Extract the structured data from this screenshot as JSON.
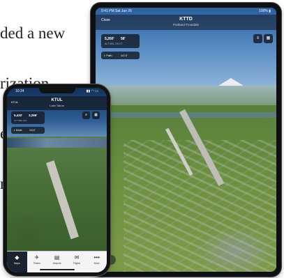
{
  "article": {
    "lines": [
      "ded a new",
      "rization",
      "egrated",
      "rt"
    ]
  },
  "tablet": {
    "status": {
      "time": "9:41 PM  Sat Jun 26",
      "right": "100% ▮"
    },
    "header": {
      "close_label": "Close",
      "title": "KTTD",
      "subtitle": "Portland-Troutdale"
    },
    "info": {
      "value_a": "5,260'",
      "value_b": "58'",
      "sub": "ALT MSL   GS KT"
    },
    "chips": {
      "a": "L Path",
      "b": "1/1.0'"
    },
    "controls": {
      "c1": "≡",
      "c2": "▦"
    }
  },
  "phone": {
    "status": {
      "time": "10:24",
      "right": "▮▮ ◠ ▭"
    },
    "header": {
      "back_label": "KTUL",
      "title": "KTUL",
      "subtitle": "Lake Tahoe"
    },
    "info": {
      "value_a": "5,432'",
      "value_b": "3,266'",
      "sub": "ALT MSL   AGL"
    },
    "chips": {
      "a": "L Mode",
      "b": "1/4,0'"
    },
    "controls": {
      "c1": "≡",
      "c2": "▦"
    },
    "tabs": [
      {
        "icon": "◆",
        "label": "Maps"
      },
      {
        "icon": "✈",
        "label": "Plates"
      },
      {
        "icon": "▤",
        "label": "Airports"
      },
      {
        "icon": "✉",
        "label": "Flights"
      },
      {
        "icon": "•••",
        "label": "More"
      }
    ]
  }
}
